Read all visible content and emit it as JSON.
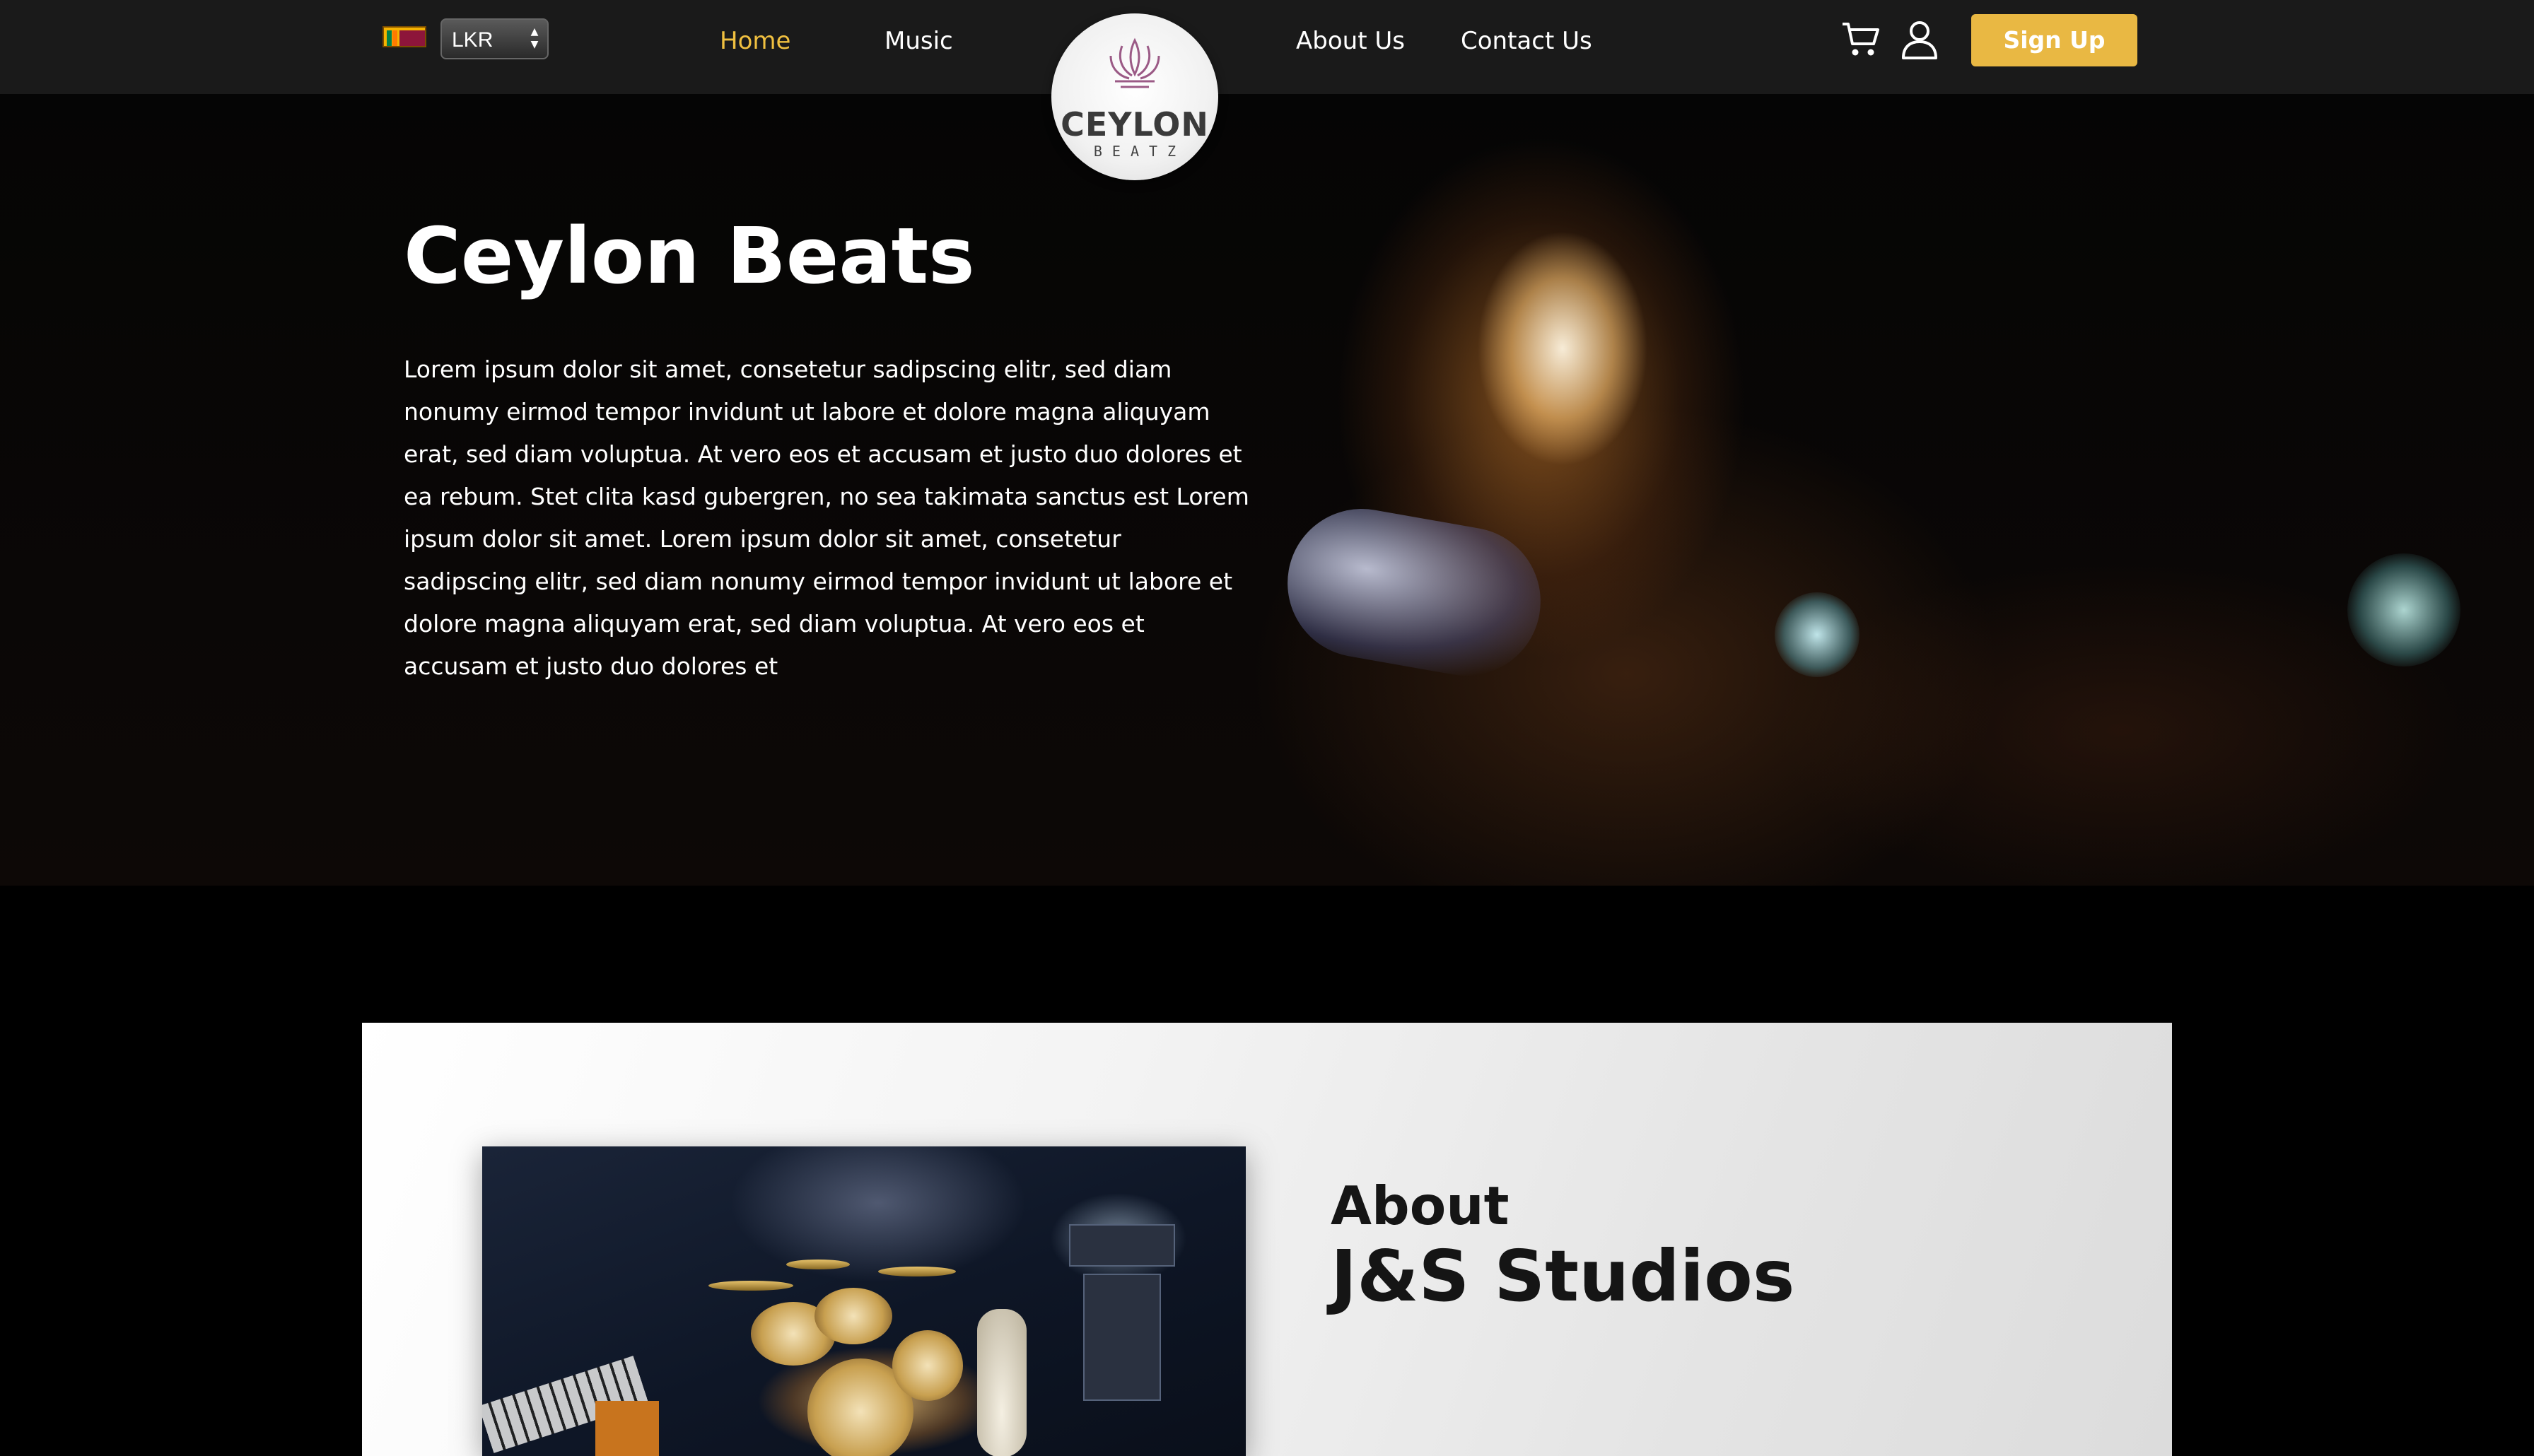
{
  "header": {
    "currency": {
      "selected": "LKR",
      "flag_icon": "sri-lanka-flag-icon"
    },
    "nav_left": [
      {
        "label": "Home",
        "active": true
      },
      {
        "label": "Music",
        "active": false
      }
    ],
    "nav_right": [
      {
        "label": "About Us"
      },
      {
        "label": "Contact Us"
      }
    ],
    "logo": {
      "brand": "CEYLON",
      "sub": "BEATZ",
      "icon": "lotus-icon"
    },
    "cart_icon": "cart-icon",
    "user_icon": "user-icon",
    "signup_label": "Sign Up"
  },
  "hero": {
    "title": "Ceylon Beats",
    "body": "Lorem ipsum dolor sit amet, consetetur sadipscing elitr, sed diam nonumy eirmod tempor invidunt ut labore et dolore magna aliquyam erat, sed diam voluptua. At vero eos et accusam et justo duo dolores et ea rebum. Stet clita kasd gubergren, no sea takimata sanctus est Lorem ipsum dolor sit amet. Lorem ipsum dolor sit amet, consetetur sadipscing elitr, sed diam nonumy eirmod tempor invidunt ut labore et dolore magna aliquyam erat, sed diam voluptua. At vero eos et accusam et justo duo dolores et"
  },
  "about": {
    "heading": "About",
    "studio_name": "J&S Studios"
  },
  "colors": {
    "accent": "#e9b843",
    "active_link": "#f0c040",
    "nav_bg": "#1a1a1a"
  }
}
